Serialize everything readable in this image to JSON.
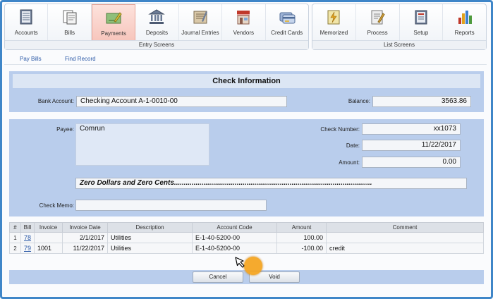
{
  "toolbar": {
    "entry_group": {
      "label": "Entry Screens",
      "items": [
        {
          "label": "Accounts",
          "icon": "ledger-icon"
        },
        {
          "label": "Bills",
          "icon": "bills-icon"
        },
        {
          "label": "Payments",
          "icon": "payment-check-icon",
          "active": true
        },
        {
          "label": "Deposits",
          "icon": "bank-icon"
        },
        {
          "label": "Journal Entries",
          "icon": "journal-icon"
        },
        {
          "label": "Vendors",
          "icon": "store-icon"
        },
        {
          "label": "Credit Cards",
          "icon": "credit-card-icon"
        }
      ]
    },
    "list_group": {
      "label": "List Screens",
      "items": [
        {
          "label": "Memorized",
          "icon": "memorized-icon"
        },
        {
          "label": "Process",
          "icon": "process-icon"
        },
        {
          "label": "Setup",
          "icon": "setup-icon"
        },
        {
          "label": "Reports",
          "icon": "reports-chart-icon"
        }
      ]
    }
  },
  "subnav": {
    "pay_bills": "Pay Bills",
    "find_record": "Find Record"
  },
  "check_info": {
    "title": "Check Information",
    "bank_account_label": "Bank Account:",
    "bank_account_value": "Checking Account A-1-0010-00",
    "balance_label": "Balance:",
    "balance_value": "3563.86"
  },
  "payee": {
    "label": "Payee:",
    "value": "Comrun",
    "check_number_label": "Check Number:",
    "check_number_value": "xx1073",
    "date_label": "Date:",
    "date_value": "11/22/2017",
    "amount_label": "Amount:",
    "amount_value": "0.00",
    "amount_words": "Zero Dollars and Zero Cents.....................................................................................................",
    "memo_label": "Check Memo:",
    "memo_value": ""
  },
  "table": {
    "headers": [
      "#",
      "Bill",
      "Invoice",
      "Invoice Date",
      "Description",
      "Account Code",
      "Amount",
      "Comment"
    ],
    "rows": [
      {
        "num": "1",
        "bill": "78",
        "invoice": "",
        "invoice_date": "2/1/2017",
        "description": "Utilities",
        "account_code": "E-1-40-5200-00",
        "amount": "100.00",
        "comment": ""
      },
      {
        "num": "2",
        "bill": "79",
        "invoice": "1001",
        "invoice_date": "11/22/2017",
        "description": "Utilities",
        "account_code": "E-1-40-5200-00",
        "amount": "-100.00",
        "comment": "credit"
      }
    ]
  },
  "buttons": {
    "cancel": "Cancel",
    "void": "Void"
  },
  "colors": {
    "frame": "#3f86c8",
    "panel": "#b9cdec",
    "highlight": "#f5a623",
    "link": "#2a58a6"
  }
}
